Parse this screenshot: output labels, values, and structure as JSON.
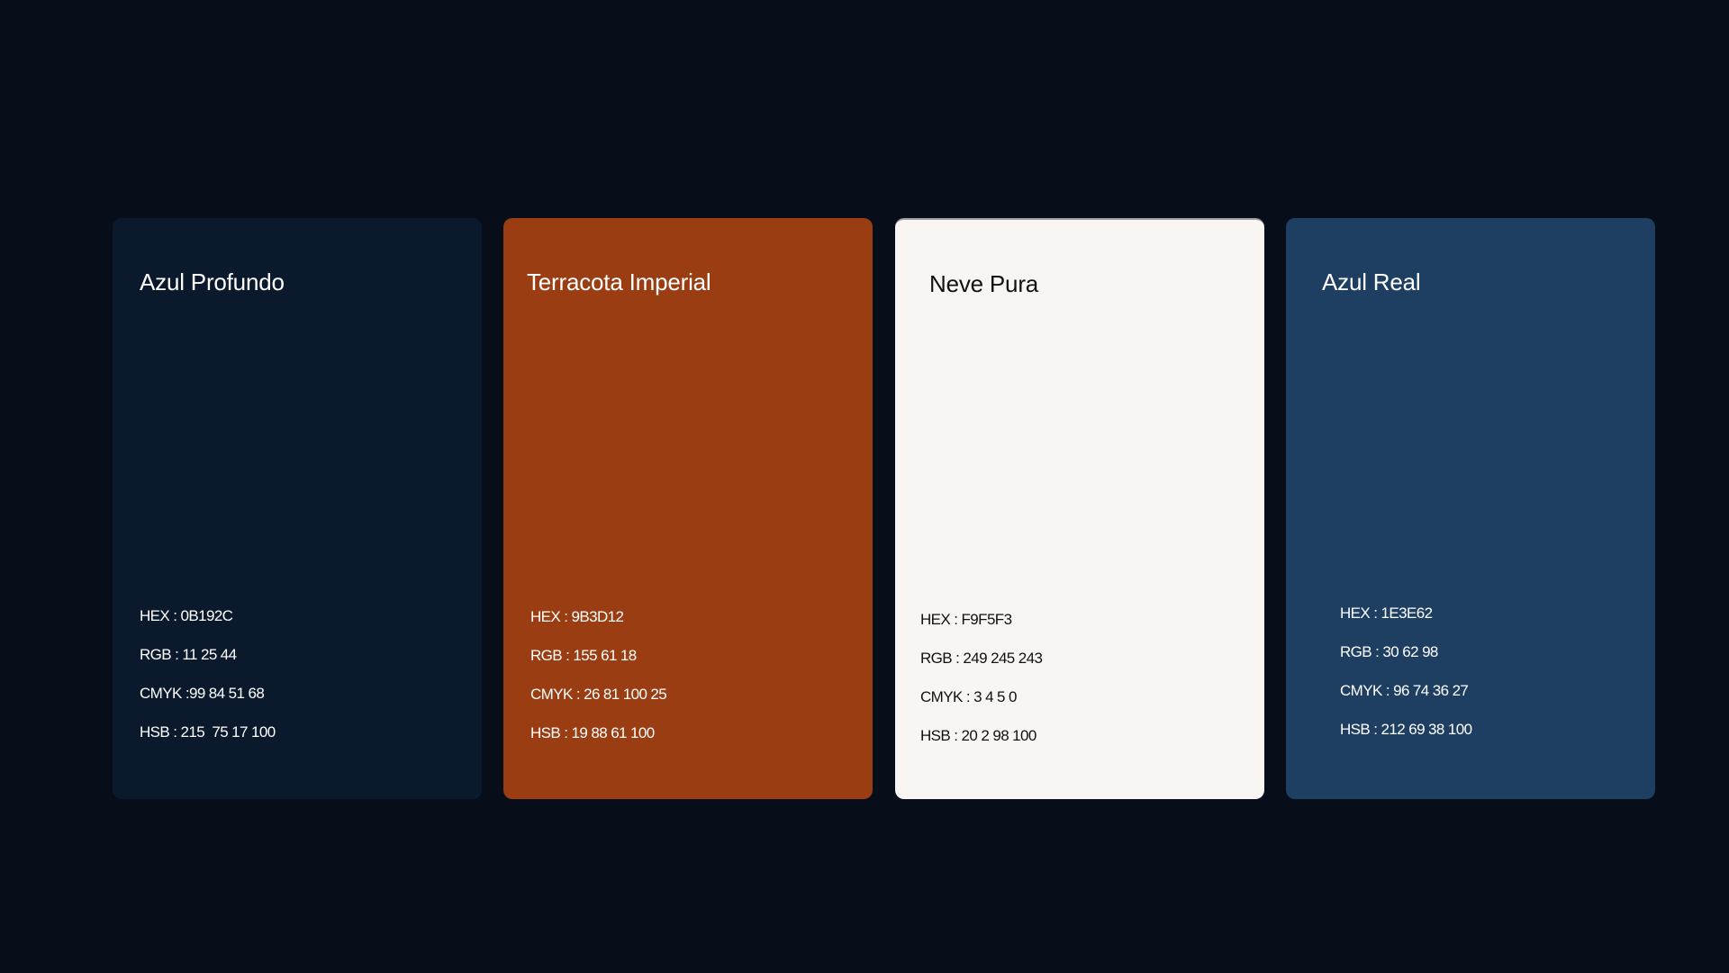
{
  "palette": [
    {
      "name": "Azul Profundo",
      "swatch_color": "#0B192C",
      "text_color": "#FFFFFF",
      "specs": [
        "HEX : 0B192C",
        "RGB : 11 25 44",
        "CMYK :99 84 51 68",
        "HSB : 215  75 17 100"
      ]
    },
    {
      "name": "Terracota Imperial",
      "swatch_color": "#9B3D12",
      "text_color": "#FFFFFF",
      "specs": [
        "HEX : 9B3D12",
        "RGB : 155 61 18",
        "CMYK : 26 81 100 25",
        "HSB : 19 88 61 100"
      ]
    },
    {
      "name": "Neve Pura",
      "swatch_color": "#F9F5F3",
      "text_color": "#111111",
      "specs": [
        "HEX : F9F5F3",
        "RGB : 249 245 243",
        "CMYK : 3 4 5 0",
        "HSB : 20 2 98 100"
      ]
    },
    {
      "name": "Azul Real",
      "swatch_color": "#1E3E62",
      "text_color": "#FFFFFF",
      "specs": [
        "HEX : 1E3E62",
        "RGB : 30 62 98",
        "CMYK : 96 74 36 27",
        "HSB : 212 69 38 100"
      ]
    }
  ]
}
